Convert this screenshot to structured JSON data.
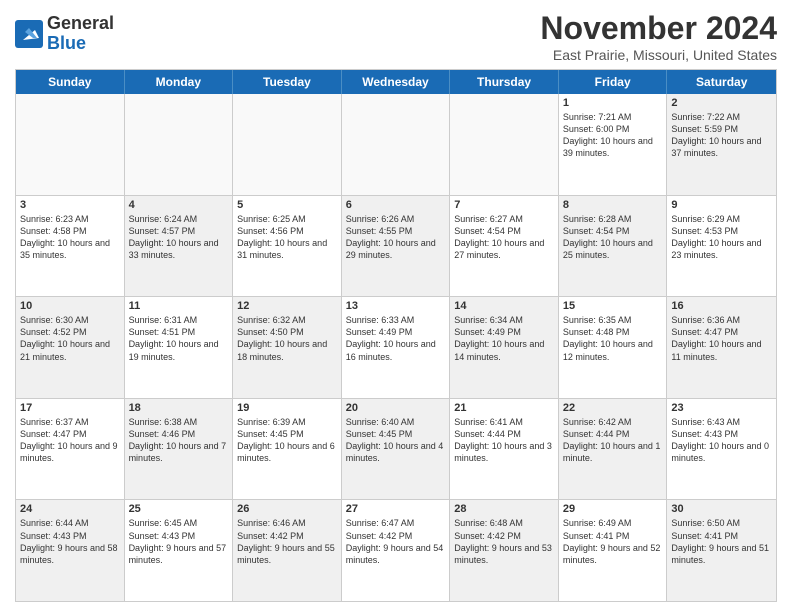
{
  "header": {
    "logo_line1": "General",
    "logo_line2": "Blue",
    "month_title": "November 2024",
    "location": "East Prairie, Missouri, United States"
  },
  "weekdays": [
    "Sunday",
    "Monday",
    "Tuesday",
    "Wednesday",
    "Thursday",
    "Friday",
    "Saturday"
  ],
  "rows": [
    [
      {
        "day": "",
        "info": "",
        "shaded": false,
        "empty": true
      },
      {
        "day": "",
        "info": "",
        "shaded": false,
        "empty": true
      },
      {
        "day": "",
        "info": "",
        "shaded": false,
        "empty": true
      },
      {
        "day": "",
        "info": "",
        "shaded": false,
        "empty": true
      },
      {
        "day": "",
        "info": "",
        "shaded": false,
        "empty": true
      },
      {
        "day": "1",
        "info": "Sunrise: 7:21 AM\nSunset: 6:00 PM\nDaylight: 10 hours and 39 minutes.",
        "shaded": false,
        "empty": false
      },
      {
        "day": "2",
        "info": "Sunrise: 7:22 AM\nSunset: 5:59 PM\nDaylight: 10 hours and 37 minutes.",
        "shaded": true,
        "empty": false
      }
    ],
    [
      {
        "day": "3",
        "info": "Sunrise: 6:23 AM\nSunset: 4:58 PM\nDaylight: 10 hours and 35 minutes.",
        "shaded": false,
        "empty": false
      },
      {
        "day": "4",
        "info": "Sunrise: 6:24 AM\nSunset: 4:57 PM\nDaylight: 10 hours and 33 minutes.",
        "shaded": true,
        "empty": false
      },
      {
        "day": "5",
        "info": "Sunrise: 6:25 AM\nSunset: 4:56 PM\nDaylight: 10 hours and 31 minutes.",
        "shaded": false,
        "empty": false
      },
      {
        "day": "6",
        "info": "Sunrise: 6:26 AM\nSunset: 4:55 PM\nDaylight: 10 hours and 29 minutes.",
        "shaded": true,
        "empty": false
      },
      {
        "day": "7",
        "info": "Sunrise: 6:27 AM\nSunset: 4:54 PM\nDaylight: 10 hours and 27 minutes.",
        "shaded": false,
        "empty": false
      },
      {
        "day": "8",
        "info": "Sunrise: 6:28 AM\nSunset: 4:54 PM\nDaylight: 10 hours and 25 minutes.",
        "shaded": true,
        "empty": false
      },
      {
        "day": "9",
        "info": "Sunrise: 6:29 AM\nSunset: 4:53 PM\nDaylight: 10 hours and 23 minutes.",
        "shaded": false,
        "empty": false
      }
    ],
    [
      {
        "day": "10",
        "info": "Sunrise: 6:30 AM\nSunset: 4:52 PM\nDaylight: 10 hours and 21 minutes.",
        "shaded": true,
        "empty": false
      },
      {
        "day": "11",
        "info": "Sunrise: 6:31 AM\nSunset: 4:51 PM\nDaylight: 10 hours and 19 minutes.",
        "shaded": false,
        "empty": false
      },
      {
        "day": "12",
        "info": "Sunrise: 6:32 AM\nSunset: 4:50 PM\nDaylight: 10 hours and 18 minutes.",
        "shaded": true,
        "empty": false
      },
      {
        "day": "13",
        "info": "Sunrise: 6:33 AM\nSunset: 4:49 PM\nDaylight: 10 hours and 16 minutes.",
        "shaded": false,
        "empty": false
      },
      {
        "day": "14",
        "info": "Sunrise: 6:34 AM\nSunset: 4:49 PM\nDaylight: 10 hours and 14 minutes.",
        "shaded": true,
        "empty": false
      },
      {
        "day": "15",
        "info": "Sunrise: 6:35 AM\nSunset: 4:48 PM\nDaylight: 10 hours and 12 minutes.",
        "shaded": false,
        "empty": false
      },
      {
        "day": "16",
        "info": "Sunrise: 6:36 AM\nSunset: 4:47 PM\nDaylight: 10 hours and 11 minutes.",
        "shaded": true,
        "empty": false
      }
    ],
    [
      {
        "day": "17",
        "info": "Sunrise: 6:37 AM\nSunset: 4:47 PM\nDaylight: 10 hours and 9 minutes.",
        "shaded": false,
        "empty": false
      },
      {
        "day": "18",
        "info": "Sunrise: 6:38 AM\nSunset: 4:46 PM\nDaylight: 10 hours and 7 minutes.",
        "shaded": true,
        "empty": false
      },
      {
        "day": "19",
        "info": "Sunrise: 6:39 AM\nSunset: 4:45 PM\nDaylight: 10 hours and 6 minutes.",
        "shaded": false,
        "empty": false
      },
      {
        "day": "20",
        "info": "Sunrise: 6:40 AM\nSunset: 4:45 PM\nDaylight: 10 hours and 4 minutes.",
        "shaded": true,
        "empty": false
      },
      {
        "day": "21",
        "info": "Sunrise: 6:41 AM\nSunset: 4:44 PM\nDaylight: 10 hours and 3 minutes.",
        "shaded": false,
        "empty": false
      },
      {
        "day": "22",
        "info": "Sunrise: 6:42 AM\nSunset: 4:44 PM\nDaylight: 10 hours and 1 minute.",
        "shaded": true,
        "empty": false
      },
      {
        "day": "23",
        "info": "Sunrise: 6:43 AM\nSunset: 4:43 PM\nDaylight: 10 hours and 0 minutes.",
        "shaded": false,
        "empty": false
      }
    ],
    [
      {
        "day": "24",
        "info": "Sunrise: 6:44 AM\nSunset: 4:43 PM\nDaylight: 9 hours and 58 minutes.",
        "shaded": true,
        "empty": false
      },
      {
        "day": "25",
        "info": "Sunrise: 6:45 AM\nSunset: 4:43 PM\nDaylight: 9 hours and 57 minutes.",
        "shaded": false,
        "empty": false
      },
      {
        "day": "26",
        "info": "Sunrise: 6:46 AM\nSunset: 4:42 PM\nDaylight: 9 hours and 55 minutes.",
        "shaded": true,
        "empty": false
      },
      {
        "day": "27",
        "info": "Sunrise: 6:47 AM\nSunset: 4:42 PM\nDaylight: 9 hours and 54 minutes.",
        "shaded": false,
        "empty": false
      },
      {
        "day": "28",
        "info": "Sunrise: 6:48 AM\nSunset: 4:42 PM\nDaylight: 9 hours and 53 minutes.",
        "shaded": true,
        "empty": false
      },
      {
        "day": "29",
        "info": "Sunrise: 6:49 AM\nSunset: 4:41 PM\nDaylight: 9 hours and 52 minutes.",
        "shaded": false,
        "empty": false
      },
      {
        "day": "30",
        "info": "Sunrise: 6:50 AM\nSunset: 4:41 PM\nDaylight: 9 hours and 51 minutes.",
        "shaded": true,
        "empty": false
      }
    ]
  ]
}
